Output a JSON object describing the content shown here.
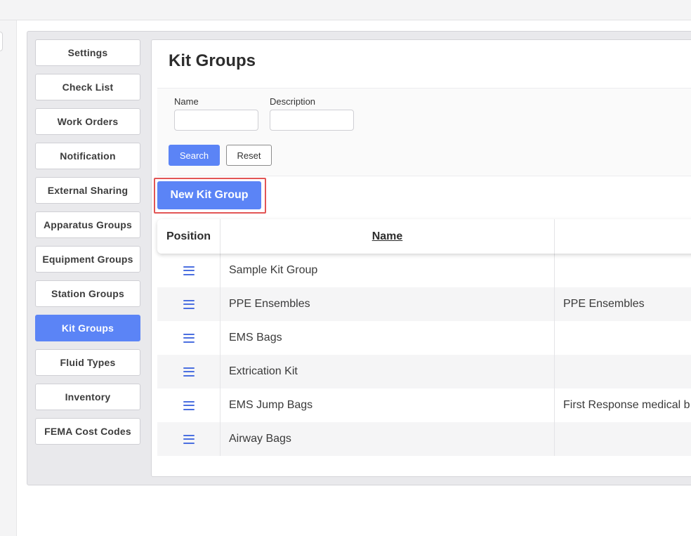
{
  "nav": {
    "items": [
      {
        "label": "Settings"
      },
      {
        "label": "Check List"
      },
      {
        "label": "Work Orders"
      },
      {
        "label": "Notification"
      },
      {
        "label": "External Sharing"
      },
      {
        "label": "Apparatus Groups"
      },
      {
        "label": "Equipment Groups"
      },
      {
        "label": "Station Groups"
      },
      {
        "label": "Kit Groups"
      },
      {
        "label": "Fluid Types"
      },
      {
        "label": "Inventory"
      },
      {
        "label": "FEMA Cost Codes"
      }
    ],
    "active": "Kit Groups"
  },
  "page": {
    "title": "Kit Groups"
  },
  "filter": {
    "name_label": "Name",
    "name_value": "",
    "description_label": "Description",
    "description_value": "",
    "search_label": "Search",
    "reset_label": "Reset"
  },
  "new_button_label": "New Kit Group",
  "table": {
    "headers": [
      "Position",
      "Name",
      ""
    ],
    "rows": [
      {
        "name": "Sample Kit Group",
        "description": ""
      },
      {
        "name": "PPE Ensembles",
        "description": "PPE Ensembles"
      },
      {
        "name": "EMS Bags",
        "description": ""
      },
      {
        "name": "Extrication Kit",
        "description": ""
      },
      {
        "name": "EMS Jump Bags",
        "description": "First Response medical b"
      },
      {
        "name": "Airway Bags",
        "description": ""
      }
    ]
  },
  "colors": {
    "accent": "#5b84f6",
    "highlight": "#e25555",
    "drag_icon": "#4b6fe0"
  }
}
